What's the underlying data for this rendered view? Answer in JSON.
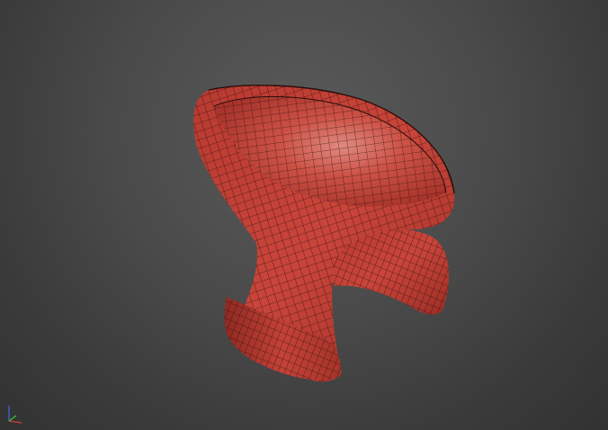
{
  "viewport": {
    "background_color": "#444444",
    "model": {
      "subject": "chair-mesh",
      "surface_color": "#c8433a",
      "wire_color": "#2a0d0b"
    },
    "axis_gizmo": {
      "icon": "axis-tripod-icon",
      "x_color": "#d23c3c",
      "y_color": "#3cc83c",
      "z_color": "#3c6cd8"
    }
  }
}
